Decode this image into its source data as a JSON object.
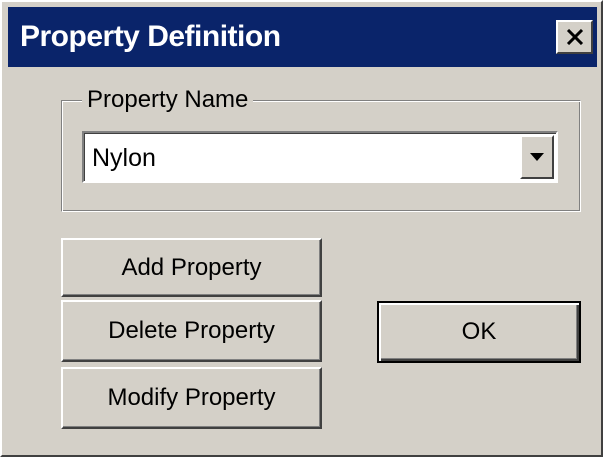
{
  "window": {
    "title": "Property Definition",
    "close_icon": "close-icon",
    "colors": {
      "titlebar": "#0a246a",
      "face": "#d4d0c8"
    }
  },
  "property_group": {
    "label": "Property Name",
    "combo": {
      "selected_value": "Nylon",
      "arrow_icon": "chevron-down-icon"
    }
  },
  "buttons": {
    "add_label": "Add Property",
    "delete_label": "Delete Property",
    "modify_label": "Modify Property",
    "ok_label": "OK"
  }
}
